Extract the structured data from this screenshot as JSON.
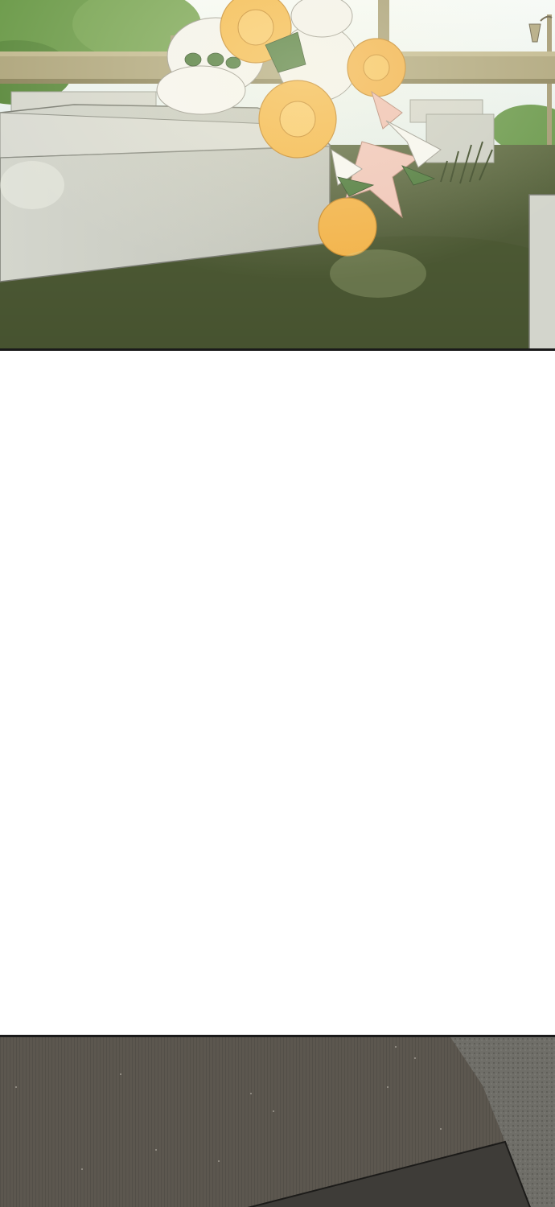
{
  "page": {
    "type": "comic-strip",
    "panels": [
      {
        "id": "panel-1",
        "scene": "flower-bouquet-on-grave"
      },
      {
        "id": "gutter",
        "scene": "blank"
      },
      {
        "id": "panel-2",
        "scene": "dark-ground-and-stone"
      }
    ]
  },
  "colors": {
    "sky": "#e9f1ef",
    "trees": "#6d9a4c",
    "fence": "#a89f78",
    "stone": "#cfd0c7",
    "grass": "#4d5b36",
    "rose_yellow": "#f2b64a",
    "rose_white": "#f3f2ee",
    "lily_pink": "#efc4b8",
    "dark_ground": "#59544c",
    "gravel": "#6f6d66"
  }
}
